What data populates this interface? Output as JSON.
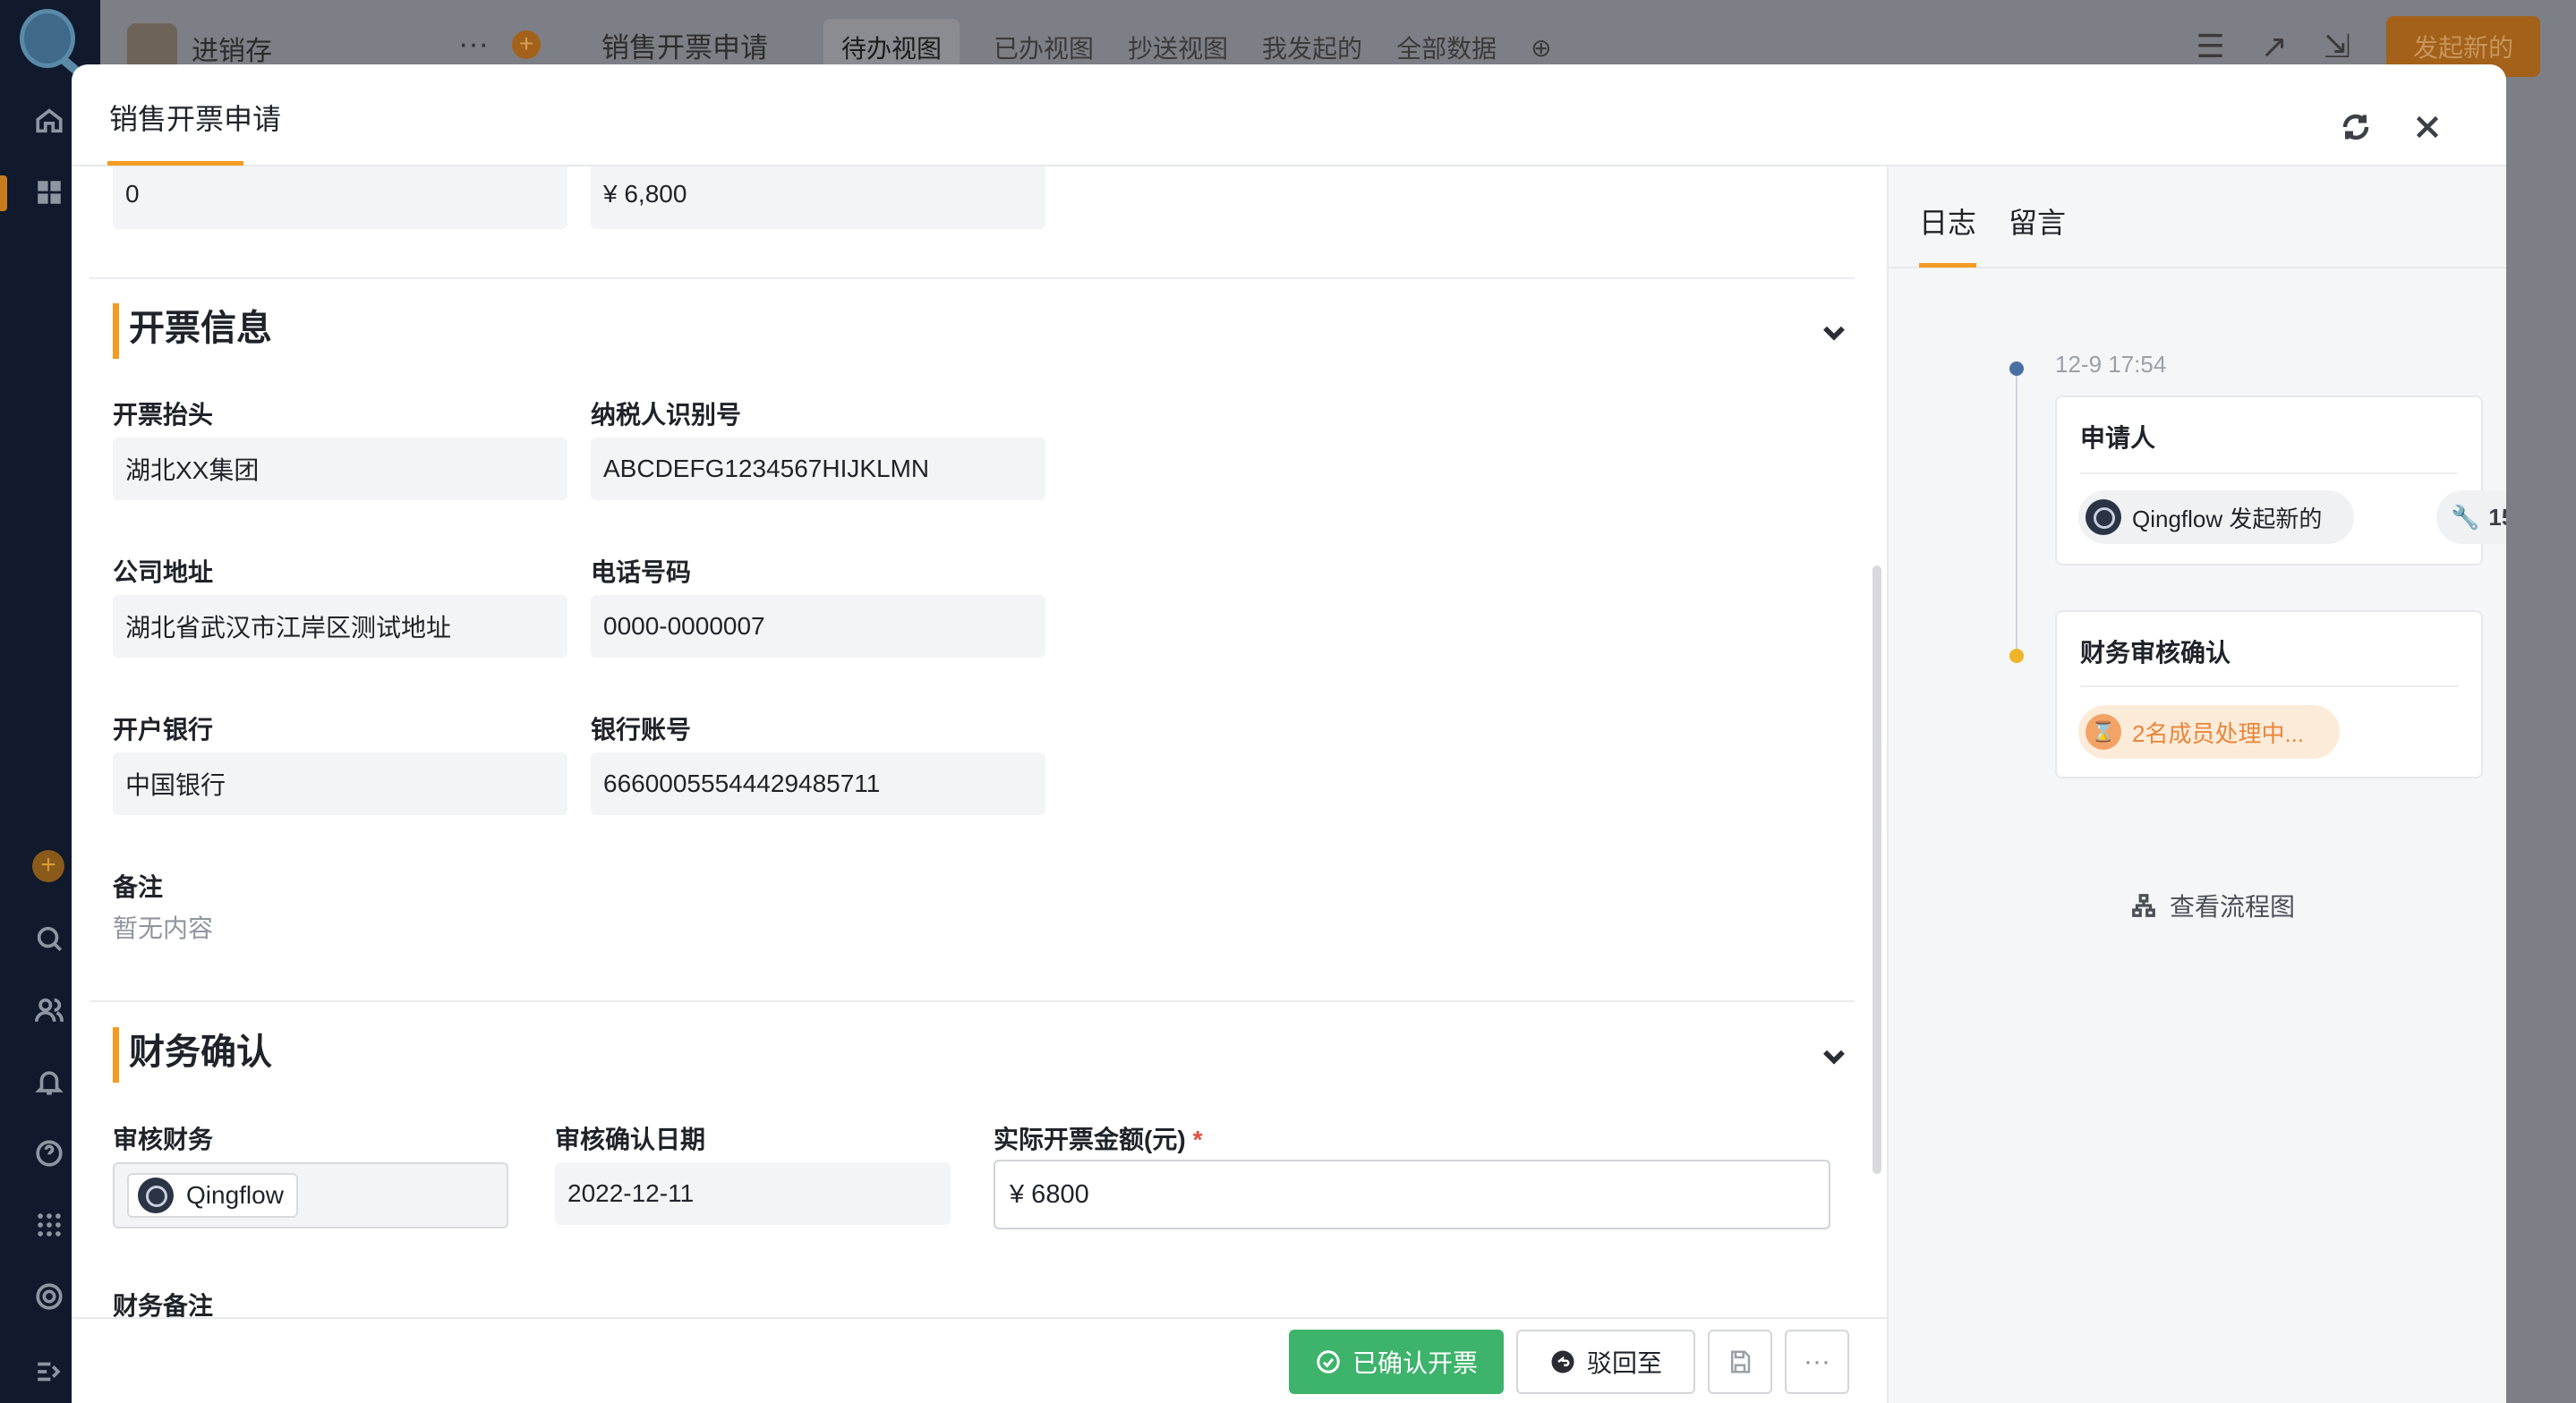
{
  "topbar": {
    "app_name": "进销存",
    "more": "···",
    "form_title": "销售开票申请",
    "views": [
      "待办视图",
      "已办视图",
      "抄送视图",
      "我发起的",
      "全部数据"
    ],
    "new_button": "发起新的"
  },
  "modal": {
    "title": "销售开票申请",
    "top_row": {
      "left_value": "0",
      "right_value": "¥ 6,800"
    },
    "section_invoice": {
      "title": "开票信息",
      "fields": [
        {
          "label": "开票抬头",
          "value": "湖北XX集团"
        },
        {
          "label": "纳税人识别号",
          "value": "ABCDEFG1234567HIJKLMN"
        },
        {
          "label": "公司地址",
          "value": "湖北省武汉市江岸区测试地址"
        },
        {
          "label": "电话号码",
          "value": "0000-0000007"
        },
        {
          "label": "开户银行",
          "value": "中国银行"
        },
        {
          "label": "银行账号",
          "value": "6660005554442948571​1"
        }
      ],
      "remark_label": "备注",
      "remark_value": "暂无内容"
    },
    "section_finance": {
      "title": "财务确认",
      "reviewer_label": "审核财务",
      "reviewer_value": "Qingflow",
      "date_label": "审核确认日期",
      "date_value": "2022-12-11",
      "amount_label": "实际开票金额(元)",
      "amount_required": "*",
      "amount_value": "¥ 6800",
      "note_label": "财务备注"
    },
    "buttons": {
      "confirm": "已确认开票",
      "reject": "驳回至",
      "more": "···"
    }
  },
  "panel": {
    "tabs": [
      "日志",
      "留言"
    ],
    "timeline": [
      {
        "time": "12-9 17:54",
        "title": "申请人",
        "user": "Qingflow 发起新的",
        "count": "15",
        "dot_color": "#4a6fa5"
      },
      {
        "title": "财务审核确认",
        "status": "2名成员处理中...",
        "dot_color": "#f0b429"
      }
    ],
    "view_flow": "查看流程图"
  },
  "colors": {
    "accent": "#f59a23",
    "primary_button": "#3db36b",
    "status_orange": "#e8863a"
  }
}
